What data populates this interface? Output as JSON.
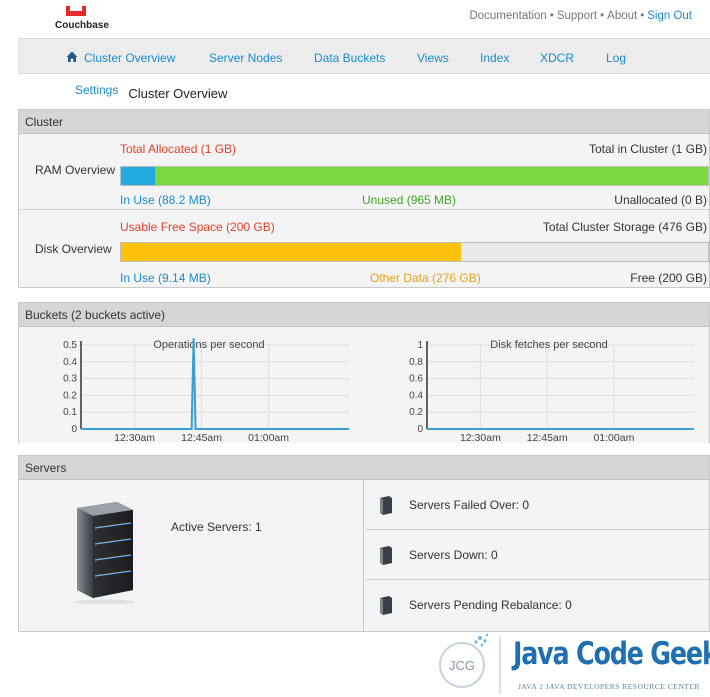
{
  "header": {
    "logo_text": "Couchbase",
    "links": [
      "Documentation",
      "Support",
      "About"
    ],
    "link_separator": "•",
    "signout": "Sign Out"
  },
  "nav": {
    "items": [
      "Cluster Overview",
      "Server Nodes",
      "Data Buckets",
      "Views",
      "Index",
      "XDCR",
      "Log"
    ]
  },
  "subnav": {
    "settings": "Settings",
    "current": "Cluster Overview"
  },
  "cluster": {
    "title": "Cluster",
    "ram": {
      "label": "RAM Overview",
      "allocated": "Total Allocated (1 GB)",
      "total": "Total in Cluster (1 GB)",
      "in_use": "In Use (88.2 MB)",
      "unused": "Unused (965 MB)",
      "unallocated": "Unallocated (0 B)",
      "in_use_fraction": 0.058,
      "unused_fraction": 0.942
    },
    "disk": {
      "label": "Disk Overview",
      "usable": "Usable Free Space (200 GB)",
      "total": "Total Cluster Storage (476 GB)",
      "in_use": "In Use (9.14 MB)",
      "other": "Other Data (276 GB)",
      "free": "Free (200 GB)",
      "other_fraction": 0.58,
      "free_fraction": 0.42
    }
  },
  "buckets": {
    "title": "Buckets (2 buckets active)",
    "charts": [
      {
        "title": "Operations per second",
        "yticks": [
          "0.5",
          "0.4",
          "0.3",
          "0.2",
          "0.1",
          "0"
        ],
        "xticks": [
          "12:30am",
          "12:45am",
          "01:00am"
        ]
      },
      {
        "title": "Disk fetches per second",
        "yticks": [
          "1",
          "0.8",
          "0.6",
          "0.4",
          "0.2",
          "0"
        ],
        "xticks": [
          "12:30am",
          "12:45am",
          "01:00am"
        ]
      }
    ]
  },
  "chart_data": [
    {
      "type": "area",
      "title": "Operations per second",
      "ylim": [
        0,
        0.5
      ],
      "x": [
        "12:15am",
        "12:30am",
        "12:44am",
        "12:45am",
        "12:46am",
        "01:00am",
        "01:10am"
      ],
      "series": [
        {
          "values": [
            0,
            0,
            0,
            0.55,
            0,
            0,
            0
          ]
        }
      ],
      "xticks": [
        "12:30am",
        "12:45am",
        "01:00am"
      ],
      "color": "#3a9fd6"
    },
    {
      "type": "area",
      "title": "Disk fetches per second",
      "ylim": [
        0,
        1
      ],
      "x": [
        "12:15am",
        "12:30am",
        "12:45am",
        "01:00am",
        "01:10am"
      ],
      "series": [
        {
          "values": [
            0,
            0,
            0,
            0,
            0
          ]
        }
      ],
      "xticks": [
        "12:30am",
        "12:45am",
        "01:00am"
      ],
      "color": "#3a9fd6"
    }
  ],
  "servers": {
    "title": "Servers",
    "active": "Active Servers: 1",
    "failed_over": "Servers Failed Over: 0",
    "down": "Servers Down: 0",
    "pending": "Servers Pending Rebalance: 0"
  },
  "watermark": {
    "badge": "JCG",
    "name": "Java Code Geeks",
    "tagline": "JAVA 2 JAVA DEVELOPERS RESOURCE CENTER"
  },
  "colors": {
    "link": "#1a8ccc",
    "red": "#e2412c",
    "ram_in_use": "#22a9e0",
    "ram_unused": "#7ad83f",
    "disk_other": "#fcc10d",
    "green_text": "#3ea427",
    "orange_text": "#e6a31c"
  }
}
